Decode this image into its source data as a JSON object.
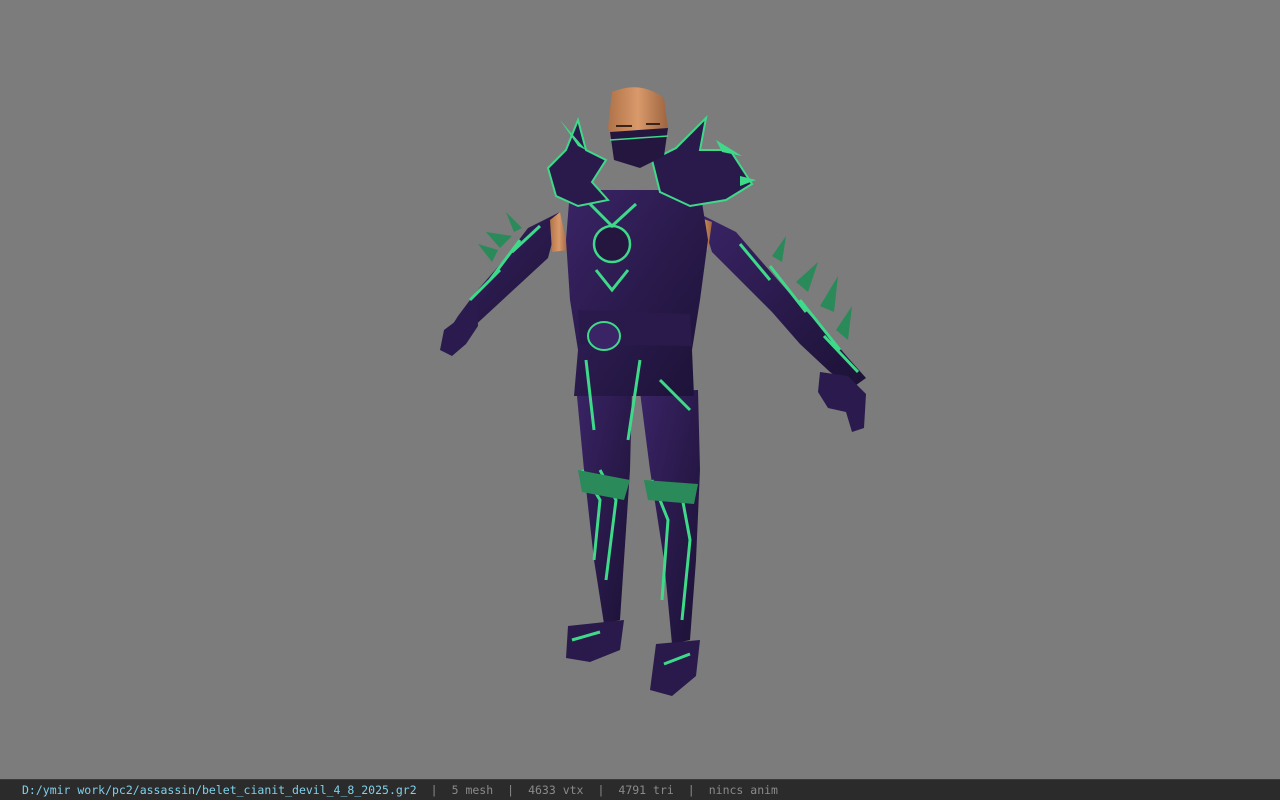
{
  "viewport": {
    "background": "#7c7c7c",
    "model": "armored-character"
  },
  "status_bar": {
    "file_path": "D:/ymir work/pc2/assassin/belet_cianit_devil_4_8_2025.gr2",
    "separator": "|",
    "mesh": "5 mesh",
    "vertices": "4633 vtx",
    "triangles": "4791 tri",
    "animation": "nincs anim",
    "colors": {
      "path": "#7fd0ea",
      "stats": "#8a8a8a",
      "background": "#2b2b2b"
    }
  }
}
